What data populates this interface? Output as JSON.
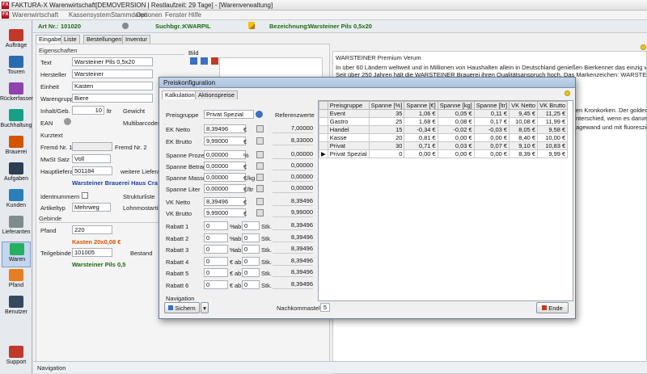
{
  "window": {
    "title": "FAKTURA-X Warenwirtschaft[DEMOVERSION | Restlaufzeit: 29 Tage] - [Warenverwaltung]"
  },
  "menu": [
    "Warenwirtschaft",
    "Kassensystem",
    "Stammdaten",
    "Optionen",
    "Fenster",
    "Hilfe"
  ],
  "sidebar": [
    {
      "label": "Aufträge",
      "icon": "orders-icon",
      "color": "#c0392b"
    },
    {
      "label": "Touren",
      "icon": "truck-icon",
      "color": "#2b6cb0"
    },
    {
      "label": "Rückerfassen",
      "icon": "return-icon",
      "color": "#8e44ad"
    },
    {
      "label": "Buchhaltung",
      "icon": "ledger-icon",
      "color": "#16a085"
    },
    {
      "label": "Brauerei",
      "icon": "brewery-icon",
      "color": "#d35400"
    },
    {
      "label": "Aufgaben",
      "icon": "tasks-icon",
      "color": "#2c3e50"
    },
    {
      "label": "Kunden",
      "icon": "customers-icon",
      "color": "#2980b9"
    },
    {
      "label": "Lieferanten",
      "icon": "suppliers-icon",
      "color": "#7f8c8d"
    },
    {
      "label": "Waren",
      "icon": "goods-icon",
      "color": "#27ae60"
    },
    {
      "label": "Pfand",
      "icon": "deposit-icon",
      "color": "#e67e22"
    },
    {
      "label": "Benutzer",
      "icon": "users-icon",
      "color": "#34495e"
    }
  ],
  "support_label": "Support",
  "header": {
    "artnr_label": "Art Nr.:",
    "artnr_value": "101020",
    "suchbgr_label": "Suchbgr.:",
    "suchbgr_value": "KWARPIL",
    "bezeichnung_label": "Bezeichnung:",
    "bezeichnung_value": "Warsteiner Pils 0,5x20"
  },
  "tabs": [
    "Eingabe",
    "Liste",
    "Bestellungen",
    "Inventur"
  ],
  "form": {
    "section_eigenschaften": "Eigenschaften",
    "text_label": "Text",
    "text_value": "Warsteiner Pils 0,5x20",
    "hersteller_label": "Hersteller",
    "hersteller_value": "Warsteiner",
    "einheit_label": "Einheit",
    "einheit_value": "Kasten",
    "warengruppe_label": "Warengruppe",
    "warengruppe_value": "Biere",
    "inhalt_label": "Inhalt/Geb.",
    "inhalt_value": "10",
    "inhalt_unit": "ltr",
    "gewicht_label": "Gewicht",
    "ean_label": "EAN",
    "multibarcodes_label": "Multibarcodes",
    "kurztext_label": "Kurztext",
    "fremd1_label": "Fremd Nr. 1",
    "fremd2_label": "Fremd Nr. 2",
    "mwst_label": "MwSt Satz",
    "mwst_value": "Voll",
    "hauptlieferant_label": "Hauptlieferant",
    "hauptlieferant_value": "501184",
    "weitere_label": "weitere Lieferant",
    "lieferant_name": "Warsteiner Brauerei Haus Cramer",
    "identnummern_label": "Identnummern",
    "strukturliste_label": "Strukturliste",
    "artikeltyp_label": "Artikeltyp",
    "artikeltyp_value": "Mehrweg",
    "lohnmost_label": "Lohnmostartikel",
    "section_gebinde": "Gebinde",
    "pfand_label": "Pfand",
    "pfand_value": "220",
    "pfand_name": "Kasten 20x0,08 €",
    "teilgebinde_label": "Teilgebinde",
    "teilgebinde_value": "101005",
    "bestand_label": "Bestand",
    "teilgebinde_name": "Warsteiner Pils 0,5",
    "bild_label": "Bild"
  },
  "description": {
    "heading": "WARSTEINER Premium Verum",
    "p1": "In über 60 Ländern weltweit und in Millionen von Haushalten allein in Deutschland genießen Bierkenner das einzig wahre WARSTEINER. Dieses",
    "p2": "Seit über 250 Jahren hält die WARSTEINER Brauerei ihren Qualitätsanspruch hoch. Das Markenzeichen: WARSTEINER Premium Verum ist durch s",
    "p3": "en Kronkorken. Der goldene WA",
    "p4": "nterschied, wenn es darum ge",
    "p5": "agewand und mit fluoreszierend"
  },
  "navigation_label": "Navigation",
  "dialog": {
    "title": "Preiskonfiguration",
    "tabs": [
      "Kalkulation",
      "Aktionspreise"
    ],
    "preisgruppe_label": "Preisgruppe",
    "preisgruppe_value": "Privat Spezial",
    "referenzwerte_label": "Referenzwerte",
    "rows": [
      {
        "label": "EK Netto",
        "value": "8,39496",
        "unit": "€",
        "ref": "7,00000"
      },
      {
        "label": "EK Brutto",
        "value": "9,99000",
        "unit": "€",
        "ref": "8,33000"
      },
      {
        "label": "Spanne Prozent",
        "value": "0,00000",
        "unit": "%",
        "ref": "0,00000"
      },
      {
        "label": "Spanne Betrag",
        "value": "0,00000",
        "unit": "€",
        "ref": "0,00000"
      },
      {
        "label": "Spanne Masse",
        "value": "0,00000",
        "unit": "€/kg",
        "ref": "0,00000"
      },
      {
        "label": "Spanne Liter",
        "value": "0,00000",
        "unit": "€/ltr",
        "ref": "0,00000"
      },
      {
        "label": "VK Netto",
        "value": "8,39496",
        "unit": "€",
        "ref": "8,39496"
      },
      {
        "label": "VK Brutto",
        "value": "9,99000",
        "unit": "€",
        "ref": "9,99000"
      }
    ],
    "rabatt": [
      {
        "label": "Rabatt 1",
        "value": "0",
        "unit": "%",
        "ab": "ab",
        "qty": "0",
        "stk": "Stk.",
        "ref": "8,39496"
      },
      {
        "label": "Rabatt 2",
        "value": "0",
        "unit": "%",
        "ab": "ab",
        "qty": "0",
        "stk": "Stk.",
        "ref": "8,39496"
      },
      {
        "label": "Rabatt 3",
        "value": "0",
        "unit": "%",
        "ab": "ab",
        "qty": "0",
        "stk": "Stk.",
        "ref": "8,39496"
      },
      {
        "label": "Rabatt 4",
        "value": "0",
        "unit": "€",
        "ab": "ab",
        "qty": "0",
        "stk": "Stk.",
        "ref": "8,39496"
      },
      {
        "label": "Rabatt 5",
        "value": "0",
        "unit": "€",
        "ab": "ab",
        "qty": "0",
        "stk": "Stk.",
        "ref": "8,39496"
      },
      {
        "label": "Rabatt 6",
        "value": "0",
        "unit": "€",
        "ab": "ab",
        "qty": "0",
        "stk": "Stk.",
        "ref": "8,39496"
      }
    ],
    "table": {
      "columns": [
        "Preisgruppe",
        "Spanne [%]",
        "Spanne [€]",
        "Spanne [kg]",
        "Spanne [ltr]",
        "VK Netto",
        "VK Brutto"
      ],
      "rows": [
        [
          "Event",
          "35",
          "1,06 €",
          "0,05 €",
          "0,11 €",
          "9,45 €",
          "11,25 €"
        ],
        [
          "Gastro",
          "25",
          "1,68 €",
          "0,08 €",
          "0,17 €",
          "10,08 €",
          "11,99 €"
        ],
        [
          "Handel",
          "15",
          "-0,34 €",
          "-0,02 €",
          "-0,03 €",
          "8,05 €",
          "9,58 €"
        ],
        [
          "Kasse",
          "20",
          "0,81 €",
          "0,00 €",
          "0,00 €",
          "8,40 €",
          "10,00 €"
        ],
        [
          "Privat",
          "30",
          "0,71 €",
          "0,03 €",
          "0,07 €",
          "9,10 €",
          "10,83 €"
        ],
        [
          "Privat Spezial",
          "0",
          "0,00 €",
          "0,00 €",
          "0,00 €",
          "8,39 €",
          "9,99 €"
        ]
      ]
    },
    "navigation_label": "Navigation",
    "save_label": "Sichern",
    "nachkomma_label": "Nachkommastellen",
    "nachkomma_value": "5",
    "end_label": "Ende"
  }
}
